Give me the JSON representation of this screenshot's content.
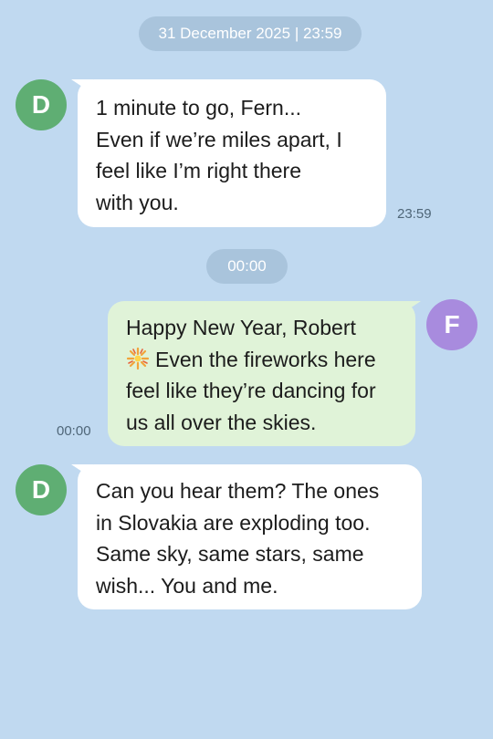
{
  "chat": {
    "date_divider": "31 December 2025 | 23:59",
    "time_divider": "00:00",
    "messages": [
      {
        "sender_initial": "D",
        "direction": "incoming",
        "lines": [
          "1 minute to go, Fern...",
          "Even if we’re miles apart, I",
          "feel like I’m right there",
          "with you."
        ],
        "time": "23:59"
      },
      {
        "sender_initial": "F",
        "direction": "outgoing",
        "lines": [
          "Happy New Year, Robert",
          "Even the fireworks here",
          "feel like they’re dancing for",
          "us all over the skies."
        ],
        "inline_icon": "firework-icon",
        "time": "00:00"
      },
      {
        "sender_initial": "D",
        "direction": "incoming",
        "lines": [
          "Can you hear them? The ones",
          "in Slovakia are exploding too.",
          "Same sky, same stars, same",
          "wish... You and me."
        ]
      }
    ]
  },
  "colors": {
    "background": "#c0d9f0",
    "divider_pill": "#a9c4dc",
    "incoming_bubble": "#ffffff",
    "outgoing_bubble": "#e0f3d8",
    "avatar_d": "#5fae73",
    "avatar_f": "#a88bde"
  }
}
